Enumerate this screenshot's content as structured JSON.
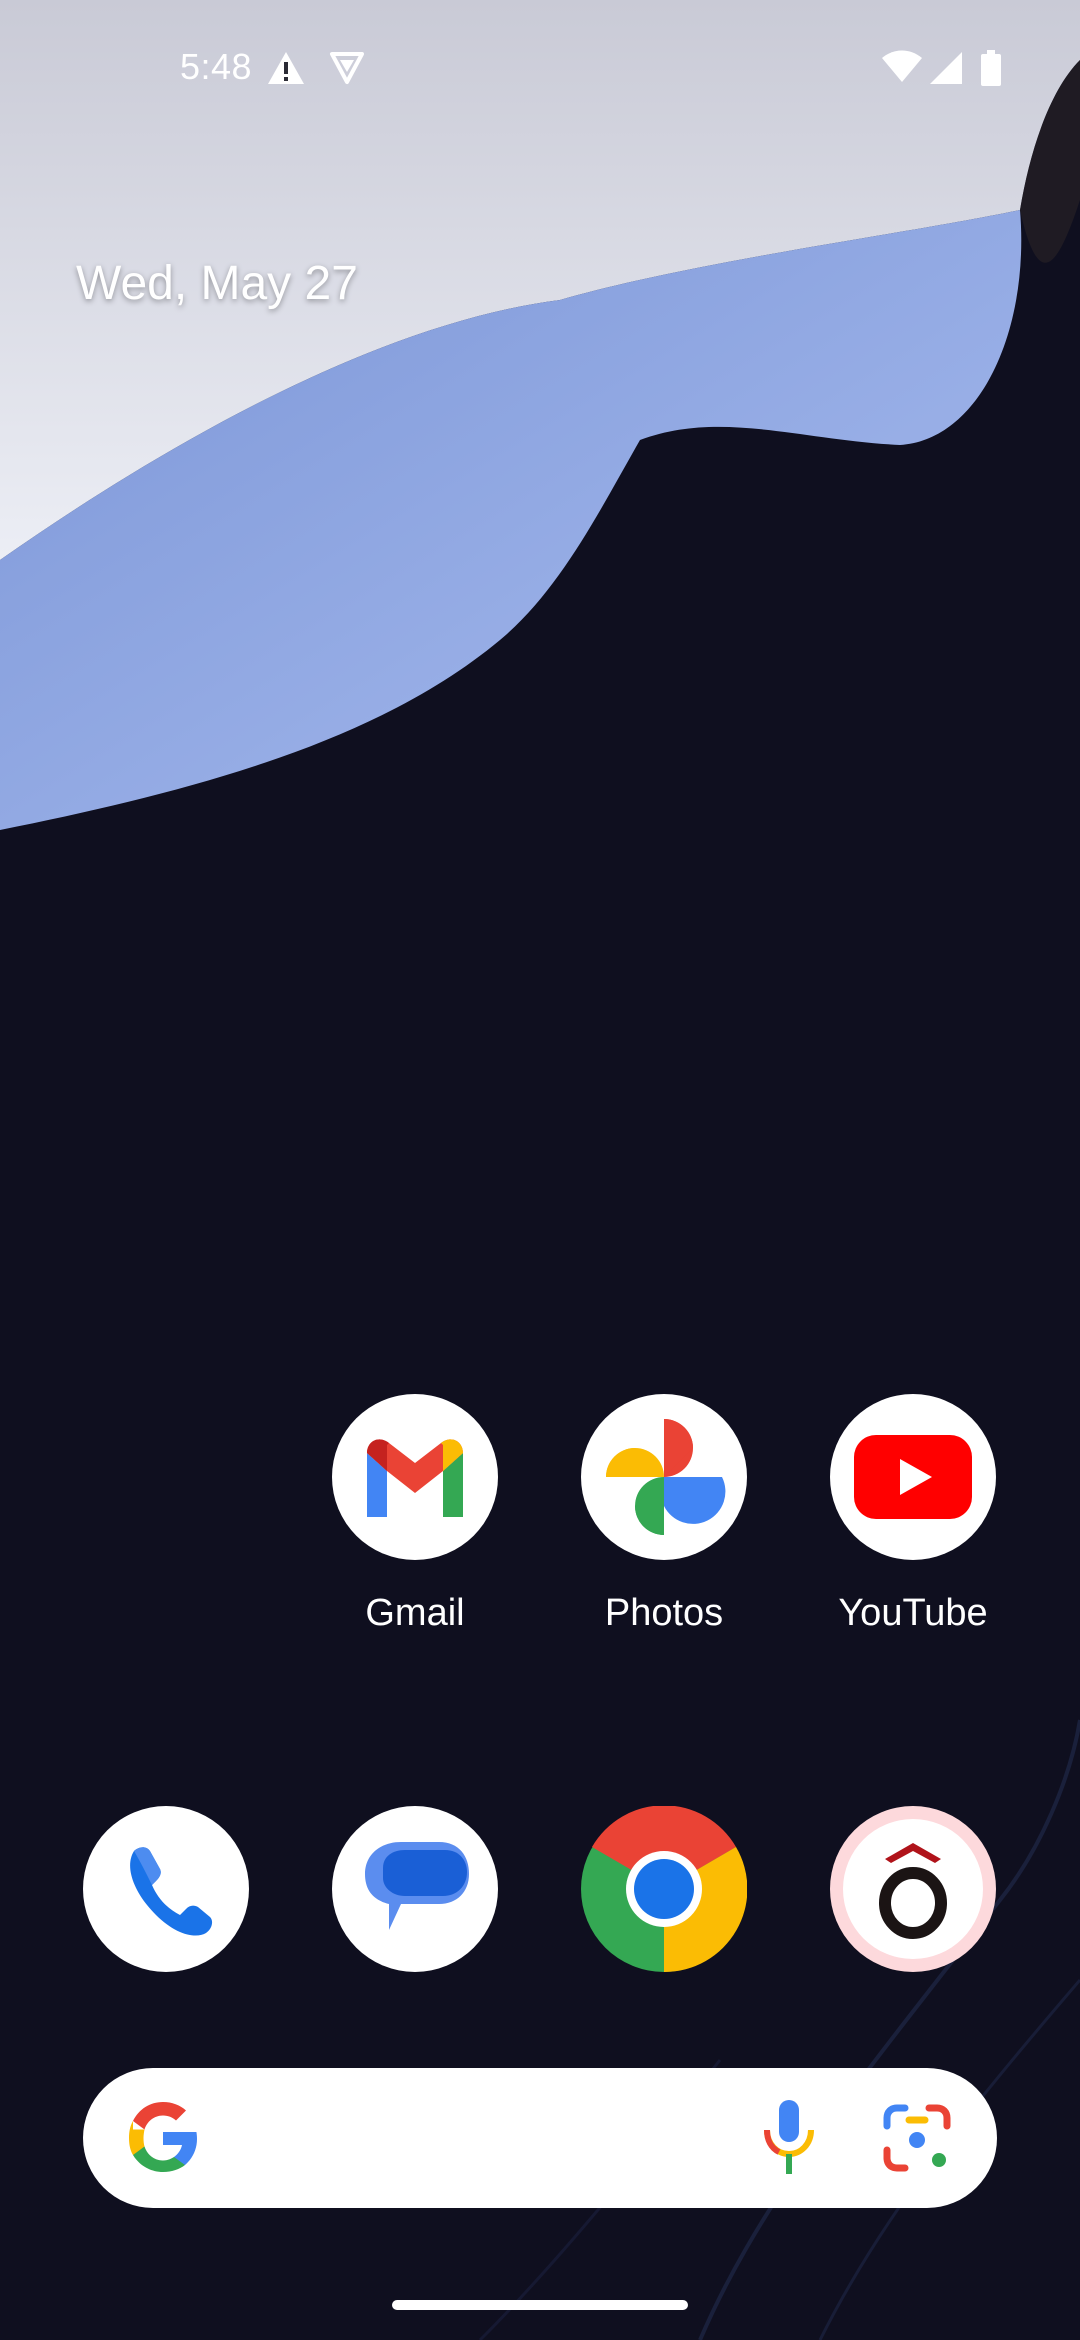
{
  "status_bar": {
    "time": "5:48",
    "icons": [
      "alert-triangle-icon",
      "vpn-shield-icon",
      "wifi-icon",
      "cell-signal-icon",
      "battery-icon"
    ]
  },
  "date_widget": {
    "text": "Wed, May 27"
  },
  "home_apps": [
    {
      "label": "Gmail",
      "icon": "gmail-icon"
    },
    {
      "label": "Photos",
      "icon": "photos-icon"
    },
    {
      "label": "YouTube",
      "icon": "youtube-icon"
    }
  ],
  "dock": [
    {
      "icon": "phone-icon"
    },
    {
      "icon": "messages-icon"
    },
    {
      "icon": "chrome-icon"
    },
    {
      "icon": "o-app-icon"
    }
  ],
  "search_bar": {
    "icons": [
      "google-g-icon",
      "microphone-icon",
      "google-lens-icon"
    ]
  },
  "colors": {
    "wallpaper_dark": "#0f0f1f",
    "wallpaper_blue": "#8fa6e0",
    "wallpaper_light": "#e4e6f0"
  }
}
